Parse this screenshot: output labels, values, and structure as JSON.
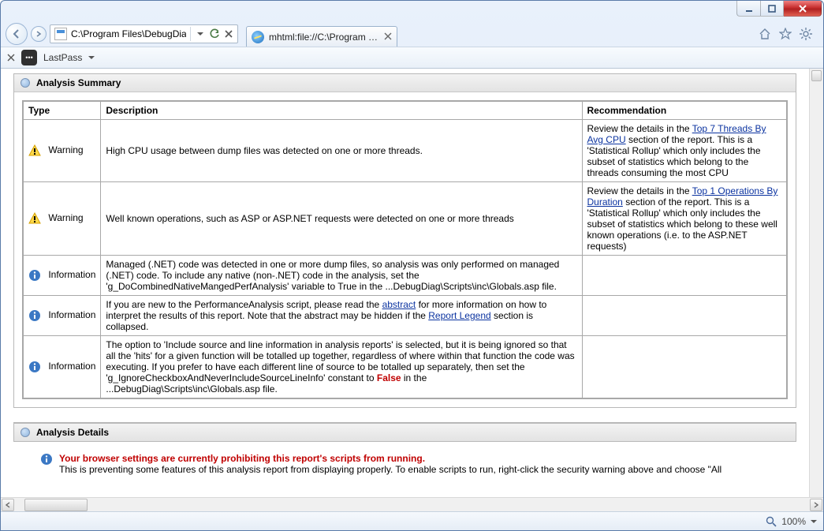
{
  "window": {
    "address_value": "C:\\Program Files\\DebugDiag\\F",
    "tab_title": "mhtml:file://C:\\Program Fil...",
    "toolbar_label": "LastPass",
    "lp_glyph": "•••",
    "zoom": "100%"
  },
  "sections": {
    "summary_title": "Analysis Summary",
    "details_title": "Analysis Details"
  },
  "summary": {
    "headers": {
      "type": "Type",
      "description": "Description",
      "recommendation": "Recommendation"
    },
    "rows": [
      {
        "kind": "Warning",
        "description": "High CPU usage between dump files was detected on one or more threads.",
        "reco_pre": "Review the details in the ",
        "reco_link": "Top 7 Threads By Avg CPU",
        "reco_post": " section of the report. This is a 'Statistical Rollup' which only includes the subset of statistics which belong to the threads consuming the most CPU"
      },
      {
        "kind": "Warning",
        "description": "Well known operations, such as ASP or ASP.NET requests were detected on one or more threads",
        "reco_pre": "Review the details in the ",
        "reco_link": "Top 1 Operations By Duration",
        "reco_post": " section of the report. This is a 'Statistical Rollup' which only includes the subset of statistics which belong to these well known operations (i.e. to the ASP.NET requests)"
      },
      {
        "kind": "Information",
        "description": "Managed (.NET) code was detected in one or more dump files, so analysis was only performed on managed (.NET) code. To include any native (non-.NET) code in the analysis, set the 'g_DoCombinedNativeMangedPerfAnalysis' variable to True in the ...DebugDiag\\Scripts\\inc\\Globals.asp file.",
        "reco_pre": "",
        "reco_link": "",
        "reco_post": ""
      },
      {
        "kind": "Information",
        "desc_pre": "If you are new to the PerformanceAnalysis script, please read the ",
        "desc_link1": "abstract",
        "desc_mid": " for more information on how to interpret the results of this report.   Note that the abstract may be hidden if the ",
        "desc_link2": "Report Legend",
        "desc_post": " section is collapsed.",
        "reco_pre": "",
        "reco_link": "",
        "reco_post": ""
      },
      {
        "kind": "Information",
        "desc_pre": "The option to 'Include source and line information in analysis reports' is selected, but it is being ignored so that all the 'hits' for a given function will be totalled up together, regardless of where within that function the code was executing. If you prefer to have each different line of source to be totalled up separately, then set the 'g_IgnoreCheckboxAndNeverIncludeSourceLineInfo' constant to ",
        "desc_red": "False",
        "desc_post": " in the ...DebugDiag\\Scripts\\inc\\Globals.asp file.",
        "reco_pre": "",
        "reco_link": "",
        "reco_post": ""
      }
    ]
  },
  "details": {
    "headline": "Your browser settings are currently prohibiting this report's scripts from running.",
    "body": "This is preventing some features of this analysis report from displaying properly. To enable scripts to run, right-click the security warning above and choose \"All"
  }
}
